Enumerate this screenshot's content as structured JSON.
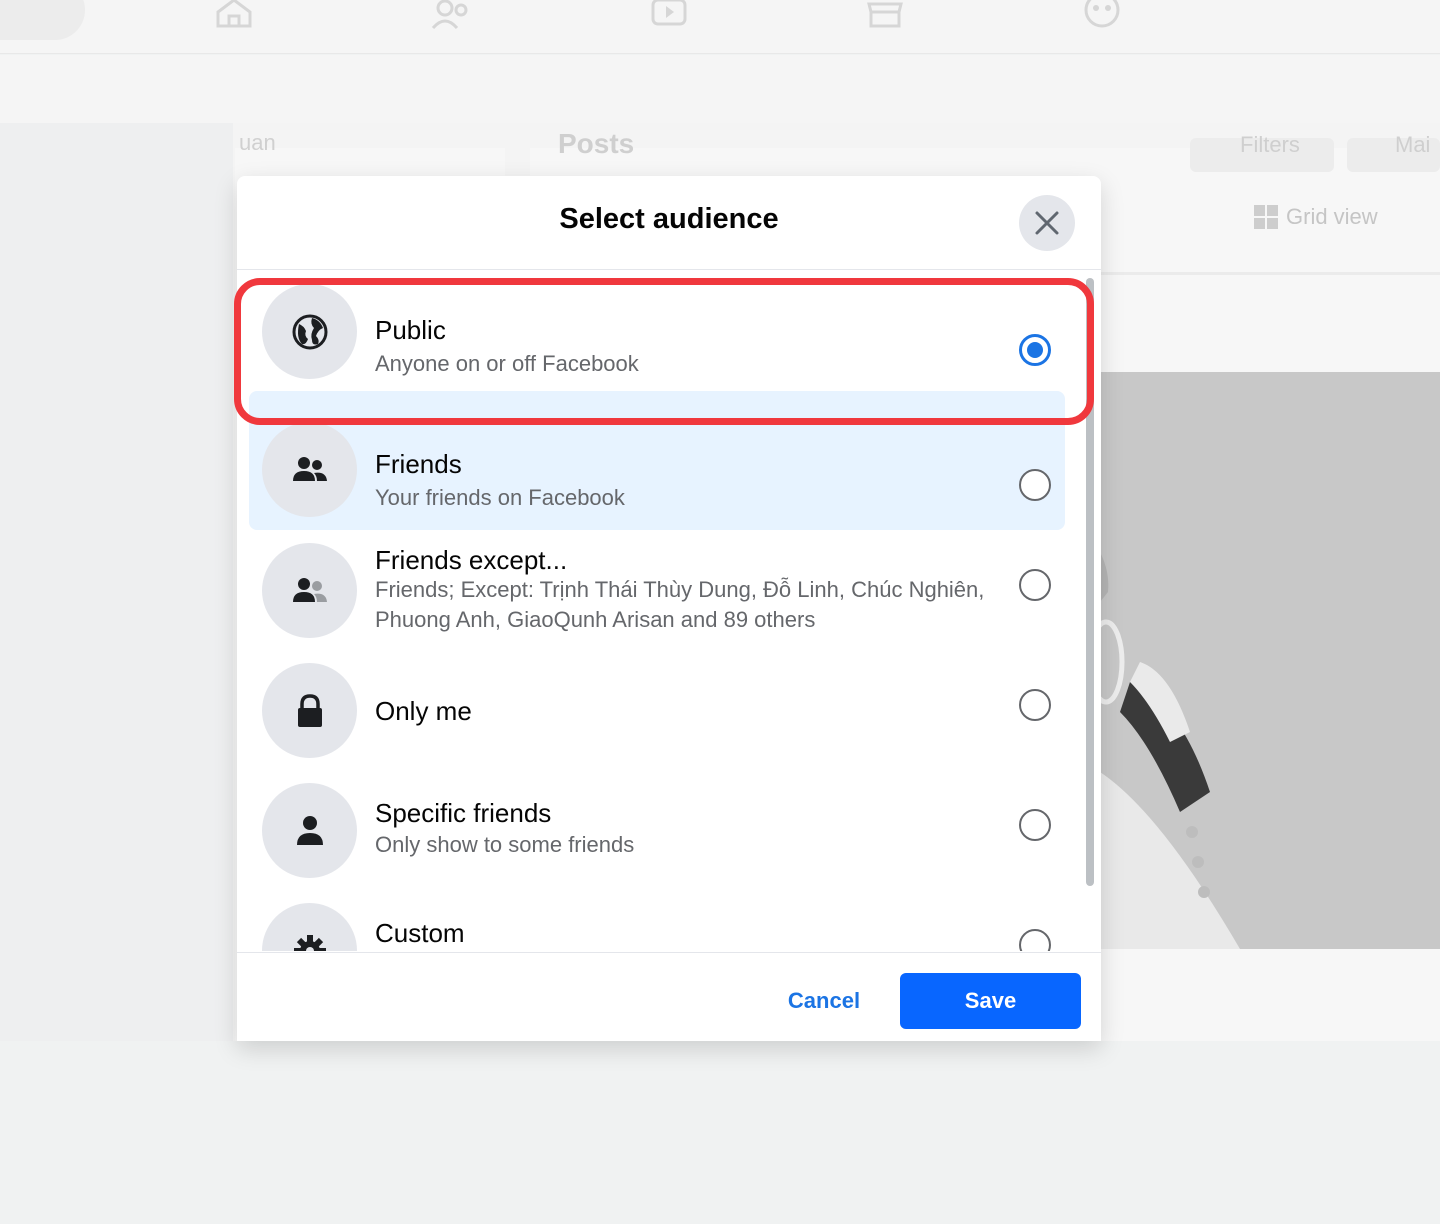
{
  "background": {
    "nav_icons": [
      "home-icon",
      "friends-icon",
      "video-icon",
      "marketplace-icon",
      "groups-icon"
    ],
    "posts_heading": "Posts",
    "grid_view_label": "Grid view",
    "faded_label": "uan",
    "filters_label": "Filters",
    "manage_label": "Mai"
  },
  "modal": {
    "title": "Select audience",
    "close_icon": "close-icon",
    "options": [
      {
        "title": "Public",
        "subtitle": "Anyone on or off Facebook",
        "icon": "globe-icon",
        "selected": true
      },
      {
        "title": "Friends",
        "subtitle": "Your friends on Facebook",
        "icon": "friends-icon",
        "selected": false
      },
      {
        "title": "Friends except...",
        "subtitle": "Friends; Except: Trịnh Thái Thùy Dung, Đỗ Linh, Chúc Nghiên, Phuong Anh, GiaoQunh Arisan and 89 others",
        "icon": "friends-except-icon",
        "selected": false
      },
      {
        "title": "Only me",
        "subtitle": "",
        "icon": "lock-icon",
        "selected": false
      },
      {
        "title": "Specific friends",
        "subtitle": "Only show to some friends",
        "icon": "person-icon",
        "selected": false
      },
      {
        "title": "Custom",
        "subtitle": "",
        "icon": "gear-icon",
        "selected": false
      }
    ],
    "cancel_label": "Cancel",
    "save_label": "Save"
  },
  "colors": {
    "accent": "#1b74e4",
    "save_button": "#0866ff",
    "highlight": "#f0383d",
    "hover_row": "#e7f3ff"
  }
}
